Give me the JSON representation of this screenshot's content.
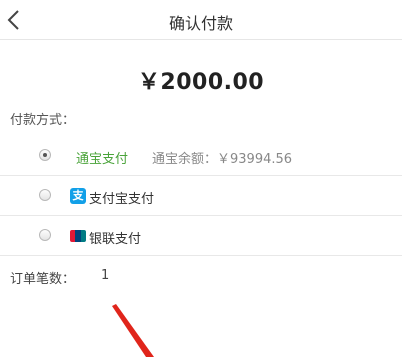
{
  "header": {
    "title": "确认付款",
    "back_icon": "chevron-left-icon"
  },
  "payment": {
    "amount": "￥2000.00"
  },
  "methods_label": "付款方式：",
  "methods": [
    {
      "name": "通宝支付",
      "balance": "通宝余额：￥93994.56",
      "selected": true,
      "icon": "",
      "accent": "#4aa33a"
    },
    {
      "name": "支付宝支付",
      "selected": false,
      "icon": "alipay-icon",
      "icon_glyph": "支",
      "accent": "#12a0e8"
    },
    {
      "name": "银联支付",
      "selected": false,
      "icon": "unionpay-icon"
    }
  ],
  "order_count": {
    "label": "订单笔数：",
    "value": "1"
  },
  "annotation": {
    "arrow_color": "#e0251b"
  }
}
